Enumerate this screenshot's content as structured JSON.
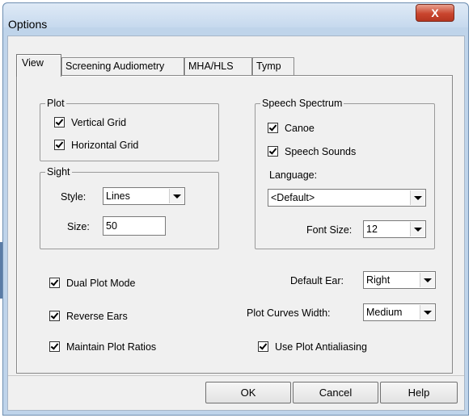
{
  "window": {
    "title": "Options",
    "close_glyph": "X"
  },
  "tabs": [
    "View",
    "Screening Audiometry",
    "MHA/HLS",
    "Tymp"
  ],
  "plot_group": {
    "legend": "Plot",
    "vertical_grid": {
      "label": "Vertical Grid",
      "checked": true
    },
    "horizontal_grid": {
      "label": "Horizontal Grid",
      "checked": true
    }
  },
  "sight_group": {
    "legend": "Sight",
    "style_label": "Style:",
    "style_value": "Lines",
    "size_label": "Size:",
    "size_value": "50"
  },
  "speech_group": {
    "legend": "Speech Spectrum",
    "canoe": {
      "label": "Canoe",
      "checked": true
    },
    "speech_sounds": {
      "label": "Speech Sounds",
      "checked": true
    },
    "language_label": "Language:",
    "language_value": "<Default>",
    "font_size_label": "Font Size:",
    "font_size_value": "12"
  },
  "options": {
    "dual_plot_mode": {
      "label": "Dual Plot Mode",
      "checked": true
    },
    "reverse_ears": {
      "label": "Reverse Ears",
      "checked": true
    },
    "maintain_plot_ratios": {
      "label": "Maintain Plot Ratios",
      "checked": true
    },
    "default_ear_label": "Default Ear:",
    "default_ear_value": "Right",
    "plot_curves_width_label": "Plot Curves Width:",
    "plot_curves_width_value": "Medium",
    "use_plot_antialiasing": {
      "label": "Use Plot Antialiasing",
      "checked": true
    }
  },
  "buttons": {
    "ok": "OK",
    "cancel": "Cancel",
    "help": "Help"
  }
}
